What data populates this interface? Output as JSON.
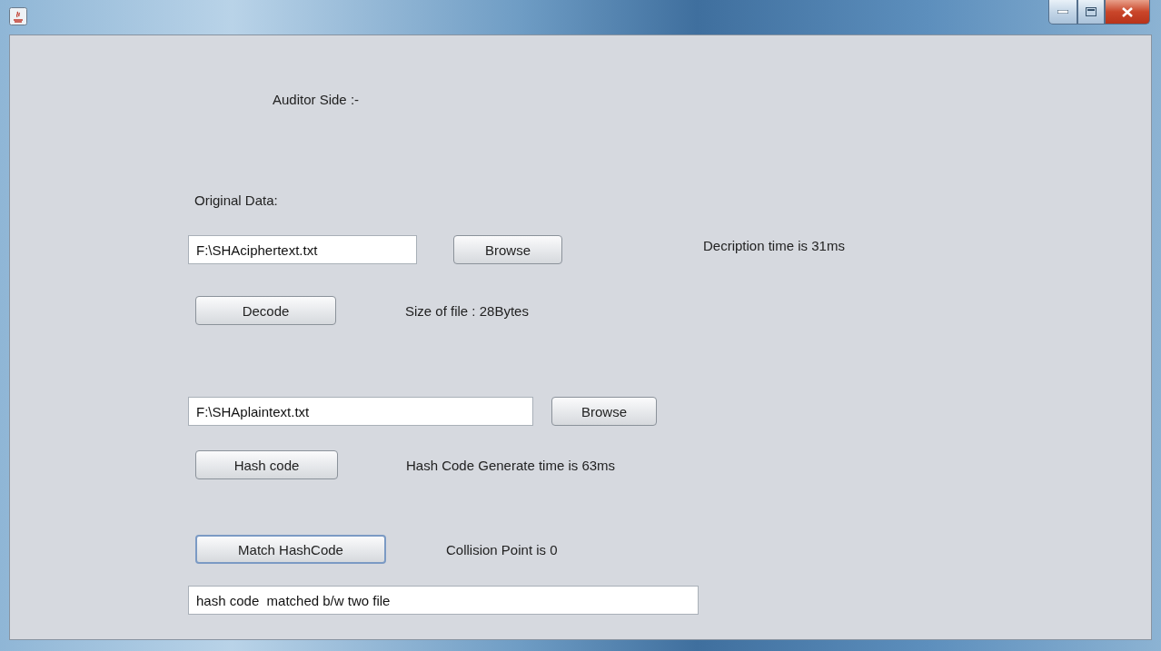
{
  "heading": "Auditor Side :-",
  "section_label": "Original Data:",
  "rows": [
    {
      "kind": "field-button-note",
      "field": "F:\\SHAciphertext.txt",
      "button": {
        "label": "Browse",
        "focused": false
      },
      "note": "Decription time is 31ms"
    },
    {
      "kind": "button-note",
      "button": {
        "label": "Decode",
        "focused": false
      },
      "note": "Size of file : 28Bytes"
    },
    {
      "kind": "field-button",
      "field": "F:\\SHAplaintext.txt",
      "button": {
        "label": "Browse",
        "focused": false
      }
    },
    {
      "kind": "button-note",
      "button": {
        "label": "Hash code",
        "focused": false
      },
      "note": "Hash Code Generate time is 63ms"
    },
    {
      "kind": "button-note",
      "button": {
        "label": "Match HashCode",
        "focused": true
      },
      "note": "Collision Point is 0"
    },
    {
      "kind": "field",
      "field": "hash code  matched b/w two file"
    }
  ]
}
